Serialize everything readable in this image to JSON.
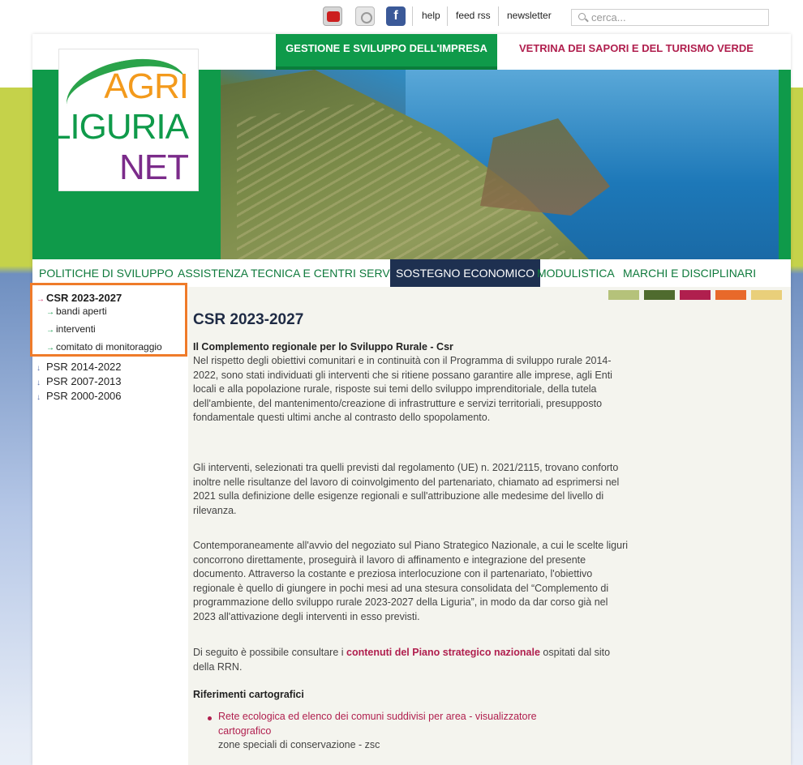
{
  "topbar": {
    "help": "help",
    "feed_rss": "feed rss",
    "newsletter": "newsletter",
    "search_placeholder": "cerca...",
    "icons": [
      "youtube-icon",
      "flickr-icon",
      "facebook-icon"
    ],
    "facebook_glyph": "f"
  },
  "header": {
    "tab_gestione": "GESTIONE E SVILUPPO DELL'IMPRESA",
    "tab_vetrina": "VETRINA DEI SAPORI E DEL TURISMO VERDE",
    "logo": {
      "line1": "AGRI",
      "line2": "LIGURIA",
      "line3": "NET"
    }
  },
  "nav": {
    "items": [
      {
        "label": "POLITICHE DI SVILUPPO"
      },
      {
        "label": "ASSISTENZA TECNICA E CENTRI SERVIZI"
      },
      {
        "label": "SOSTEGNO ECONOMICO",
        "active": true
      },
      {
        "label": "MODULISTICA"
      },
      {
        "label": "MARCHI E DISCIPLINARI"
      }
    ]
  },
  "sidebar": {
    "items": [
      {
        "label": "CSR 2023-2027",
        "arrow": "→",
        "active": true
      },
      {
        "label": "bandi aperti",
        "arrow": "→"
      },
      {
        "label": "interventi",
        "arrow": "→"
      },
      {
        "label": "comitato di monitoraggio",
        "arrow": "→"
      },
      {
        "label": "PSR 2014-2022",
        "arrow": "↓"
      },
      {
        "label": "PSR 2007-2013",
        "arrow": "↓"
      },
      {
        "label": "PSR 2000-2006",
        "arrow": "↓"
      }
    ]
  },
  "content": {
    "swatch_colors": [
      "#b5c27a",
      "#4f6b2e",
      "#b01f4e",
      "#e8692a",
      "#e9cf7a"
    ],
    "title": "CSR 2023-2027",
    "subtitle": "Il Complemento regionale per lo Sviluppo Rurale - Csr",
    "p1": "Nel rispetto degli obiettivi comunitari e in continuità con il Programma di sviluppo rurale 2014-2022, sono stati individuati gli interventi che si ritiene possano garantire alle imprese, agli Enti locali e alla popolazione rurale, risposte sui temi dello sviluppo imprenditoriale, della tutela dell'ambiente, del mantenimento/creazione di infrastrutture e servizi territoriali, presupposto fondamentale questi ultimi anche al contrasto dello spopolamento.",
    "p2": "Gli interventi, selezionati tra quelli previsti dal regolamento (UE) n. 2021/2115, trovano conforto inoltre nelle risultanze del lavoro di coinvolgimento del partenariato, chiamato ad esprimersi nel 2021 sulla definizione delle esigenze regionali e sull'attribuzione alle medesime del livello di rilevanza.",
    "p3": "Contemporaneamente all'avvio del negoziato sul Piano Strategico Nazionale, a cui le scelte liguri concorrono direttamente, proseguirà il lavoro di affinamento e integrazione del presente documento. Attraverso la costante e preziosa interlocuzione con il partenariato, l'obiettivo regionale è quello di giungere in pochi mesi ad una stesura consolidata del “Complemento di programmazione dello sviluppo rurale 2023-2027 della Liguria”, in modo da dar corso già nel 2023 all'attivazione degli interventi in esso previsti.",
    "p4_before": "Di seguito è possibile consultare i ",
    "p4_link": "contenuti del Piano strategico nazionale",
    "p4_after": " ospitati dal sito della RRN.",
    "heading_carto": "Riferimenti cartografici",
    "bullet_link": "Rete ecologica ed elenco dei comuni suddivisi per area - visualizzatore cartografico",
    "bullet_text": "zone speciali di conservazione - zsc"
  }
}
